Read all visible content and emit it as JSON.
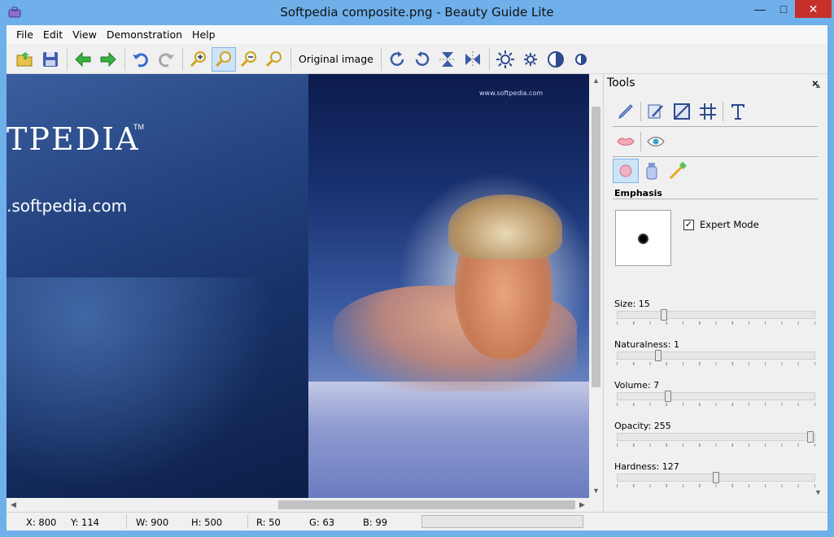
{
  "window": {
    "title": "Softpedia composite.png - Beauty Guide Lite"
  },
  "menu": [
    "File",
    "Edit",
    "View",
    "Demonstration",
    "Help"
  ],
  "toolbar": {
    "original_label": "Original image"
  },
  "image": {
    "brand": "TPEDIA",
    "trademark": "TM",
    "url": ".softpedia.com",
    "watermark_url": "www.softpedia.com"
  },
  "panel": {
    "title": "Tools",
    "close": "×",
    "section": "Emphasis",
    "expert_label": "Expert Mode",
    "expert_checked": true,
    "sliders": [
      {
        "label": "Size: 15",
        "value": 0.23
      },
      {
        "label": "Naturalness: 1",
        "value": 0.2
      },
      {
        "label": "Volume: 7",
        "value": 0.25
      },
      {
        "label": "Opacity: 255",
        "value": 0.99
      },
      {
        "label": "Hardness: 127",
        "value": 0.5
      }
    ]
  },
  "status": {
    "x": "X: 800",
    "y": "Y: 114",
    "w": "W: 900",
    "h": "H: 500",
    "r": "R: 50",
    "g": "G: 63",
    "b": "B: 99"
  },
  "colors": {
    "titlebar": "#6fb0ea",
    "close": "#c7302a",
    "accent": "#cce4f7"
  }
}
